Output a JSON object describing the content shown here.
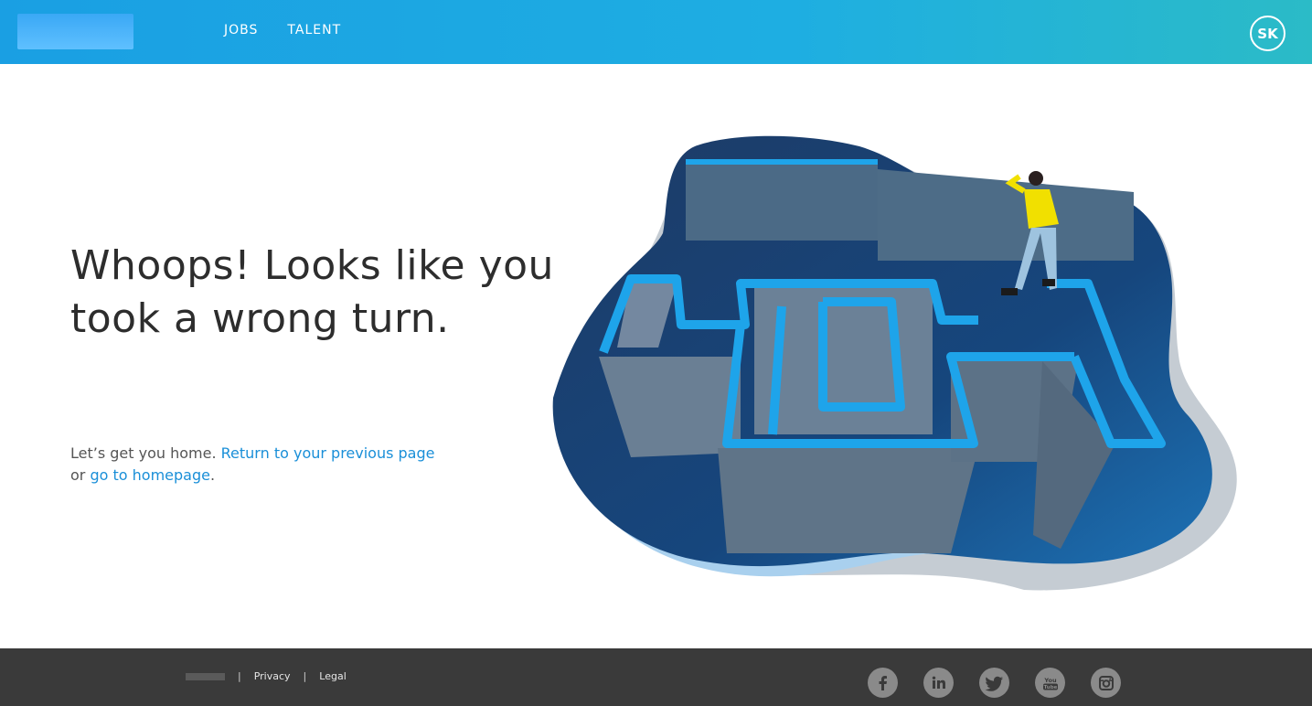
{
  "header": {
    "nav": [
      {
        "label": "JOBS"
      },
      {
        "label": "TALENT"
      }
    ],
    "avatar_initials": "SK",
    "brand_color": "#1a9fe3"
  },
  "main": {
    "headline": "Whoops! Looks like you took a wrong turn.",
    "help_prefix": "Let’s get you home. ",
    "return_link": "Return to your previous page",
    "or_text": "or ",
    "home_link": "go to homepage",
    "period": "."
  },
  "footer": {
    "separator": "|",
    "links": [
      {
        "label": "Privacy"
      },
      {
        "label": "Legal"
      }
    ],
    "social": [
      {
        "icon": "facebook-icon"
      },
      {
        "icon": "linkedin-icon"
      },
      {
        "icon": "twitter-icon"
      },
      {
        "icon": "youtube-icon",
        "label": "You Tube"
      },
      {
        "icon": "instagram-icon"
      }
    ]
  }
}
